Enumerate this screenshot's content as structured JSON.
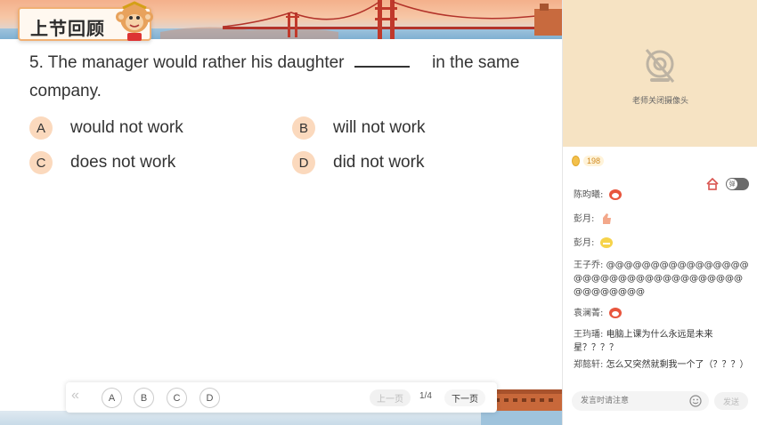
{
  "slide": {
    "section_title": "上节回顾",
    "question": {
      "number": "5.",
      "text_before": "The manager would rather his daughter",
      "text_after": "in the same company."
    },
    "options": [
      {
        "letter": "A",
        "text": "would not work"
      },
      {
        "letter": "B",
        "text": "will not work"
      },
      {
        "letter": "C",
        "text": "does not work"
      },
      {
        "letter": "D",
        "text": "did not work"
      }
    ],
    "toolbar": {
      "back_glyph": "«",
      "choices": [
        "A",
        "B",
        "C",
        "D"
      ],
      "prev_label": "上一页",
      "page_indicator": "1/4",
      "next_label": "下一页"
    }
  },
  "panel": {
    "camera_status": "老师关闭摄像头",
    "coin_count": "198",
    "toggle_label": "弹",
    "messages": [
      {
        "user": "陈昀曦:",
        "text": "",
        "emoji": "laugh-red"
      },
      {
        "user": "彭月:",
        "text": "",
        "emoji": "thumbs"
      },
      {
        "user": "彭月:",
        "text": "",
        "emoji": "grin-yellow"
      },
      {
        "user": "王子乔:",
        "text": "@@@@@@@@@@@@@@@@@@@@@@@@@@@@@@@@@@@@@@@@@@@",
        "emoji": ""
      },
      {
        "user": "袁澜菁:",
        "text": "",
        "emoji": "laugh-red"
      },
      {
        "user": "王玙璠:",
        "text": "电脑上课为什么永远是未来星？？？？",
        "emoji": ""
      },
      {
        "user": "郑懿轩:",
        "text": "怎么又突然就剩我一个了（？？？）",
        "emoji": ""
      }
    ],
    "input_placeholder": "发言时请注意",
    "send_label": "发送"
  },
  "colors": {
    "accent_orange": "#f1b073",
    "option_badge": "#fbd9bd",
    "camera_bg": "#f6e3c3"
  }
}
